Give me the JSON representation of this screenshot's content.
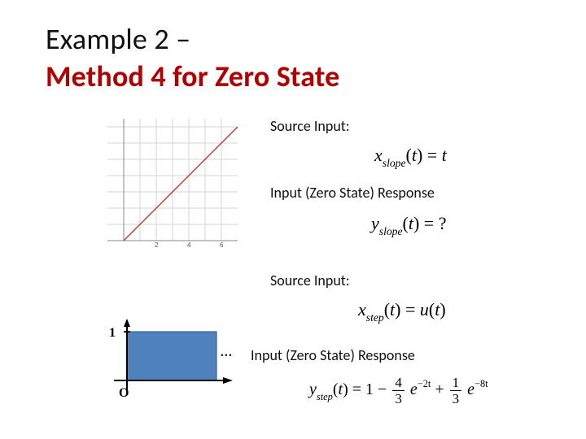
{
  "title": {
    "line1": "Example 2 –",
    "line2": "Method 4 for Zero State"
  },
  "section1": {
    "source_label": "Source Input:",
    "source_eq": {
      "var": "x",
      "sub": "slope",
      "arg": "t",
      "rhs": "t"
    },
    "response_label": "Input (Zero State) Response",
    "response_eq": {
      "var": "y",
      "sub": "slope",
      "arg": "t",
      "rhs": "?"
    }
  },
  "section2": {
    "source_label": "Source Input:",
    "source_eq": {
      "var": "x",
      "sub": "step",
      "arg": "t",
      "rhs_fn": "u",
      "rhs_arg": "t"
    },
    "response_label": "Input (Zero State) Response",
    "response_eq": {
      "var": "y",
      "sub": "step",
      "arg": "t",
      "terms": [
        {
          "sign": "",
          "coef_num": "",
          "coef_den": "",
          "literal": "1"
        },
        {
          "sign": "−",
          "coef_num": "4",
          "coef_den": "3",
          "exp": "−2t"
        },
        {
          "sign": "+",
          "coef_num": "1",
          "coef_den": "3",
          "exp": "−8t"
        }
      ]
    }
  },
  "ellipsis": "…",
  "slope_graph": {
    "x_range": [
      0,
      6
    ],
    "y_range": [
      0,
      6
    ],
    "ticks_x": [
      "2",
      "4",
      "6"
    ],
    "line": {
      "x1": 0,
      "y1": 0,
      "x2": 6,
      "y2": 6
    }
  },
  "step_graph": {
    "y_tick": "1",
    "origin_label": "O"
  }
}
